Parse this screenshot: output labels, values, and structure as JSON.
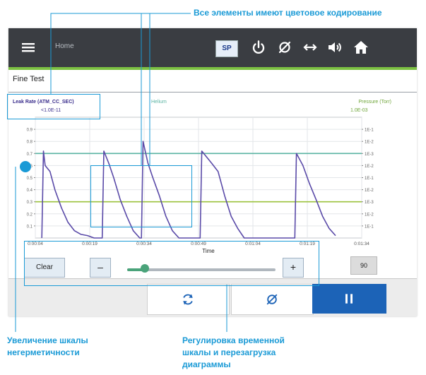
{
  "callouts": {
    "color_coding": "Все элементы имеют цветовое кодирование",
    "leak_scale_line1": "Увеличение шкалы",
    "leak_scale_line2": "негерметичности",
    "time_scale_line1": "Регулировка временной",
    "time_scale_line2": "шкалы и перезагрузка",
    "time_scale_line3": "диаграммы"
  },
  "header": {
    "menu_icon": "hamburger-icon",
    "home_label": "Home",
    "sp_label": "SP",
    "icons": [
      "power-icon",
      "null-icon",
      "arrows-horizontal-icon",
      "speaker-icon",
      "home-icon"
    ]
  },
  "page": {
    "title": "Fine Test"
  },
  "chart_data": {
    "type": "line",
    "left_axis": {
      "label": "Leak Rate (ATM_CC_SEC)",
      "scale_label": "<1.0E-11",
      "ticks": [
        "0.9",
        "0.8",
        "0.7",
        "0.6",
        "0.5",
        "0.4",
        "0.3",
        "0.2",
        "0.1"
      ],
      "range": [
        0,
        1.0
      ]
    },
    "middle_label": "Helium",
    "right_axis": {
      "label": "Pressure (Torr)",
      "scale_label": "1.0E-03",
      "ticks": [
        "1E-1",
        "1E-2",
        "1E-3",
        "1E-2",
        "1E-1",
        "1E-2",
        "1E-3",
        "1E-2",
        "1E-1"
      ],
      "range": [
        0,
        1.0
      ]
    },
    "x_ticks": [
      "0:00:04",
      "0:00:19",
      "0:00:34",
      "0:00:49",
      "0:01:04",
      "0:01:19",
      "0:01:34"
    ],
    "xlabel": "Time",
    "reference_lines": [
      {
        "color": "#5ab3a2",
        "value": 0.7
      },
      {
        "color": "#9bc23c",
        "value": 0.3
      }
    ],
    "series": [
      {
        "color": "#5a4aa8",
        "points": [
          [
            0.02,
            0.0
          ],
          [
            0.025,
            0.72
          ],
          [
            0.03,
            0.6
          ],
          [
            0.045,
            0.55
          ],
          [
            0.06,
            0.4
          ],
          [
            0.08,
            0.25
          ],
          [
            0.1,
            0.13
          ],
          [
            0.12,
            0.06
          ],
          [
            0.14,
            0.03
          ],
          [
            0.16,
            0.02
          ],
          [
            0.18,
            0.0
          ],
          [
            0.205,
            0.0
          ],
          [
            0.21,
            0.72
          ],
          [
            0.225,
            0.62
          ],
          [
            0.24,
            0.5
          ],
          [
            0.26,
            0.32
          ],
          [
            0.28,
            0.18
          ],
          [
            0.3,
            0.06
          ],
          [
            0.32,
            0.0
          ],
          [
            0.325,
            0.0
          ],
          [
            0.33,
            0.8
          ],
          [
            0.345,
            0.62
          ],
          [
            0.36,
            0.5
          ],
          [
            0.38,
            0.35
          ],
          [
            0.4,
            0.18
          ],
          [
            0.42,
            0.06
          ],
          [
            0.44,
            0.0
          ],
          [
            0.505,
            0.0
          ],
          [
            0.51,
            0.72
          ],
          [
            0.54,
            0.62
          ],
          [
            0.56,
            0.55
          ],
          [
            0.58,
            0.35
          ],
          [
            0.6,
            0.18
          ],
          [
            0.62,
            0.08
          ],
          [
            0.64,
            0.0
          ],
          [
            0.795,
            0.0
          ],
          [
            0.8,
            0.7
          ],
          [
            0.82,
            0.6
          ],
          [
            0.84,
            0.45
          ],
          [
            0.86,
            0.32
          ],
          [
            0.88,
            0.18
          ],
          [
            0.9,
            0.08
          ],
          [
            0.92,
            0.02
          ]
        ]
      }
    ]
  },
  "controls": {
    "clear_label": "Clear",
    "minus_label": "–",
    "plus_label": "+",
    "slider_value": 0.12,
    "value_label": "90"
  },
  "bottom_buttons": {
    "reload_icon": "refresh-icon",
    "null_icon": "null-icon",
    "pause_icon": "pause-icon"
  },
  "colors": {
    "accent": "#1a9ad6",
    "topbar": "#3a3d42",
    "green_strip": "#7cc142",
    "pause": "#1c63b7"
  }
}
